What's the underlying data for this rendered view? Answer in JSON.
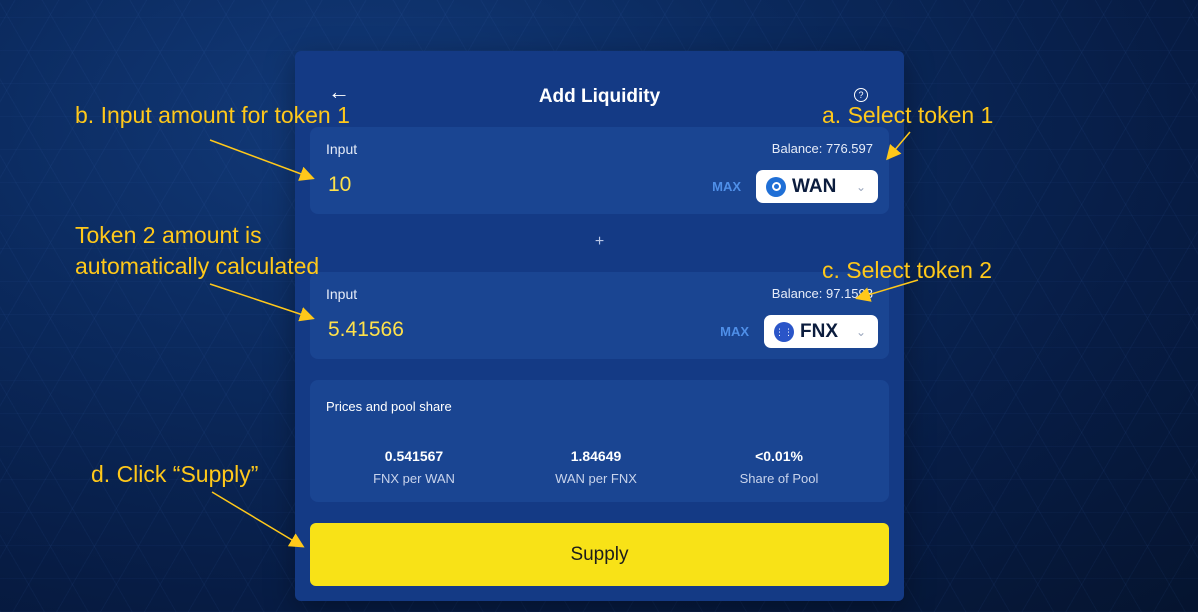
{
  "header": {
    "title": "Add Liquidity",
    "back_icon": "arrow-left-icon",
    "help_icon": "question-circle-icon"
  },
  "input1": {
    "label": "Input",
    "balance": "Balance: 776.597",
    "amount": "10",
    "max_label": "MAX",
    "token": {
      "symbol": "WAN",
      "icon": "wan-token-icon"
    }
  },
  "separator": "+",
  "input2": {
    "label": "Input",
    "balance": "Balance: 97.1593",
    "amount": "5.41566",
    "max_label": "MAX",
    "token": {
      "symbol": "FNX",
      "icon": "fnx-token-icon"
    }
  },
  "prices": {
    "title": "Prices and pool share",
    "items": [
      {
        "value": "0.541567",
        "label": "FNX per WAN"
      },
      {
        "value": "1.84649",
        "label": "WAN per FNX"
      },
      {
        "value": "<0.01%",
        "label": "Share of Pool"
      }
    ]
  },
  "supply_label": "Supply",
  "annotations": {
    "a": "a. Select token 1",
    "b": "b. Input amount for token 1",
    "c": "c. Select token 2",
    "d": "d. Click “Supply”",
    "token2_line1": "Token 2 amount is",
    "token2_line2": "automatically calculated"
  },
  "colors": {
    "background": "#0b2a5e",
    "card": "#143a85",
    "panel": "#1a4592",
    "accent_yellow": "#f8e217",
    "annotation": "#ffc81a",
    "amount": "#ffe14a"
  }
}
